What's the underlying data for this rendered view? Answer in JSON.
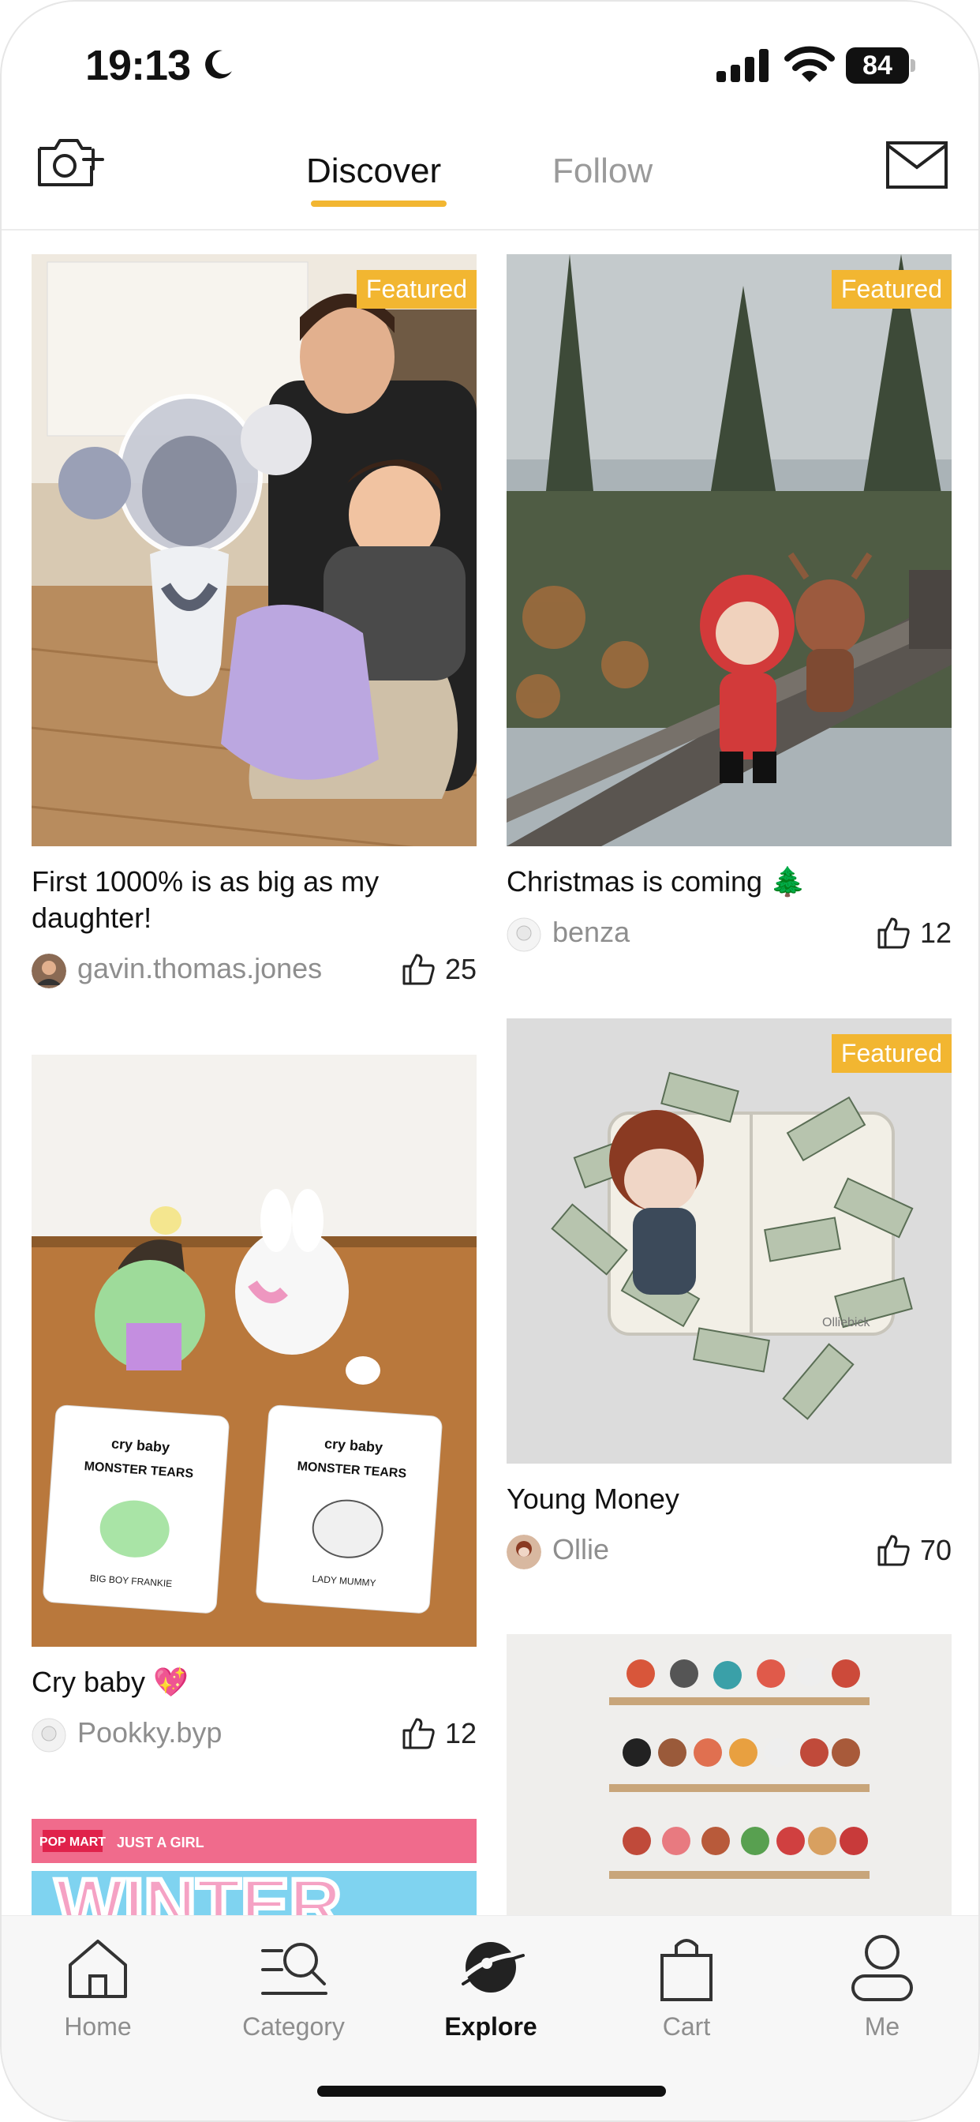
{
  "status_bar": {
    "time": "19:13",
    "battery": "84"
  },
  "header": {
    "tabs": [
      {
        "label": "Discover",
        "active": true
      },
      {
        "label": "Follow",
        "active": false
      }
    ]
  },
  "colors": {
    "accent": "#f2b631",
    "muted_text": "#8e8e8e"
  },
  "feed": {
    "left": [
      {
        "title": "First 1000% is as big as my daughter!",
        "author": "gavin.thomas.jones",
        "likes": "25",
        "badge": "Featured"
      },
      {
        "title": "Cry baby 💖",
        "author": "Pookky.byp",
        "likes": "12",
        "badge": ""
      },
      {
        "banner_brand": "POP MART",
        "banner_tag": "JUST A GIRL",
        "banner_word": "WINTER"
      }
    ],
    "right": [
      {
        "title": "Christmas is coming 🌲",
        "author": "benza",
        "likes": "12",
        "badge": "Featured"
      },
      {
        "title": "Young Money",
        "author": "Ollie",
        "likes": "70",
        "badge": "Featured"
      }
    ]
  },
  "card_images": {
    "cry_brand": "cry baby",
    "cry_series": "MONSTER TEARS",
    "cry_card_left": "BIG BOY FRANKIE",
    "cry_card_right": "LADY MUMMY",
    "money_watermark": "Olliebick"
  },
  "tabbar": {
    "items": [
      {
        "label": "Home",
        "icon": "home-icon",
        "active": false
      },
      {
        "label": "Category",
        "icon": "category-search-icon",
        "active": false
      },
      {
        "label": "Explore",
        "icon": "planet-icon",
        "active": true
      },
      {
        "label": "Cart",
        "icon": "shopping-bag-icon",
        "active": false
      },
      {
        "label": "Me",
        "icon": "person-icon",
        "active": false
      }
    ]
  }
}
